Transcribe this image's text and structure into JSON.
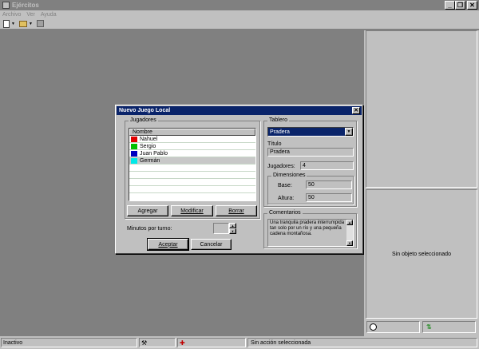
{
  "app": {
    "title": "Ejércitos"
  },
  "menu": [
    {
      "label": "Archivo"
    },
    {
      "label": "Ver"
    },
    {
      "label": "Ayuda"
    }
  ],
  "dialog": {
    "title": "Nuevo Juego Local",
    "players_group": "Jugadores",
    "players_header": "Nombre",
    "players": [
      {
        "name": "Nahuel",
        "color": "#e00000"
      },
      {
        "name": "Sergio",
        "color": "#00c000"
      },
      {
        "name": "Juan Pablo",
        "color": "#0000c0"
      },
      {
        "name": "Germán",
        "color": "#00e8e8"
      }
    ],
    "add_label": "Agregar",
    "modify_label": "Modificar",
    "delete_label": "Borrar",
    "minutes_label": "Minutos por turno:",
    "minutes_value": "",
    "accept_label": "Aceptar",
    "cancel_label": "Cancelar",
    "board_group": "Tablero",
    "board_selected": "Pradera",
    "title_label": "Título",
    "title_value": "Pradera",
    "players_count_label": "Jugadores:",
    "players_count_value": "4",
    "dimensions_group": "Dimensiones",
    "base_label": "Base:",
    "base_value": "50",
    "height_label": "Altura:",
    "height_value": "50",
    "comments_group": "Comentarios",
    "comments_text": "Una tranquila pradera interrumpida tan solo por un río y una pequeña cadena montañosa."
  },
  "right_panel": {
    "no_object": "Sin objeto seleccionado"
  },
  "status": {
    "state": "Inactivo",
    "action": "Sin acción seleccionada"
  }
}
